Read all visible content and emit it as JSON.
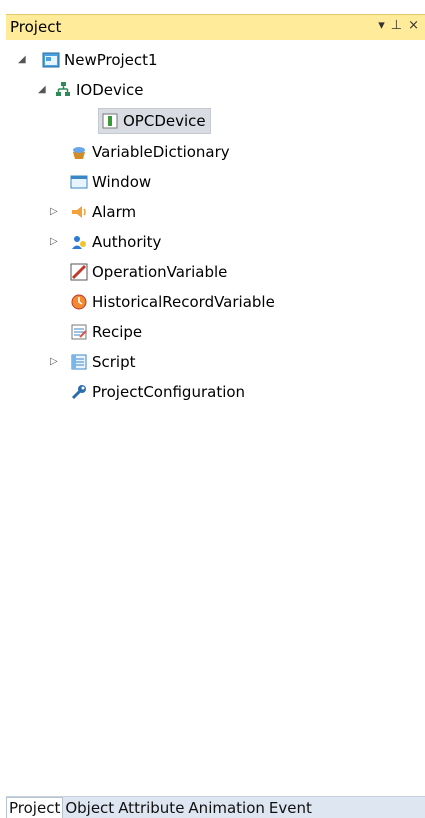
{
  "panel": {
    "title": "Project",
    "controls": {
      "dropdown_icon": "dropdown-icon",
      "pin_icon": "pin-icon",
      "close_icon": "close-icon",
      "dropdown_glyph": "▾",
      "pin_glyph": "⊥",
      "close_glyph": "×"
    }
  },
  "tree": {
    "root": {
      "label": "NewProject1"
    },
    "items": [
      {
        "label": "IODevice"
      },
      {
        "label": "OPCDevice"
      },
      {
        "label": "VariableDictionary"
      },
      {
        "label": "Window"
      },
      {
        "label": "Alarm"
      },
      {
        "label": "Authority"
      },
      {
        "label": "OperationVariable"
      },
      {
        "label": "HistoricalRecordVariable"
      },
      {
        "label": "Recipe"
      },
      {
        "label": "Script"
      },
      {
        "label": "ProjectConfiguration"
      }
    ]
  },
  "tabs": [
    "Project",
    "Object",
    "Attribute",
    "Animation",
    "Event"
  ],
  "colors": {
    "title_bar": "#ffeb9a",
    "selected_item": "#d9dde3",
    "tab_bar": "#dde6f1"
  }
}
